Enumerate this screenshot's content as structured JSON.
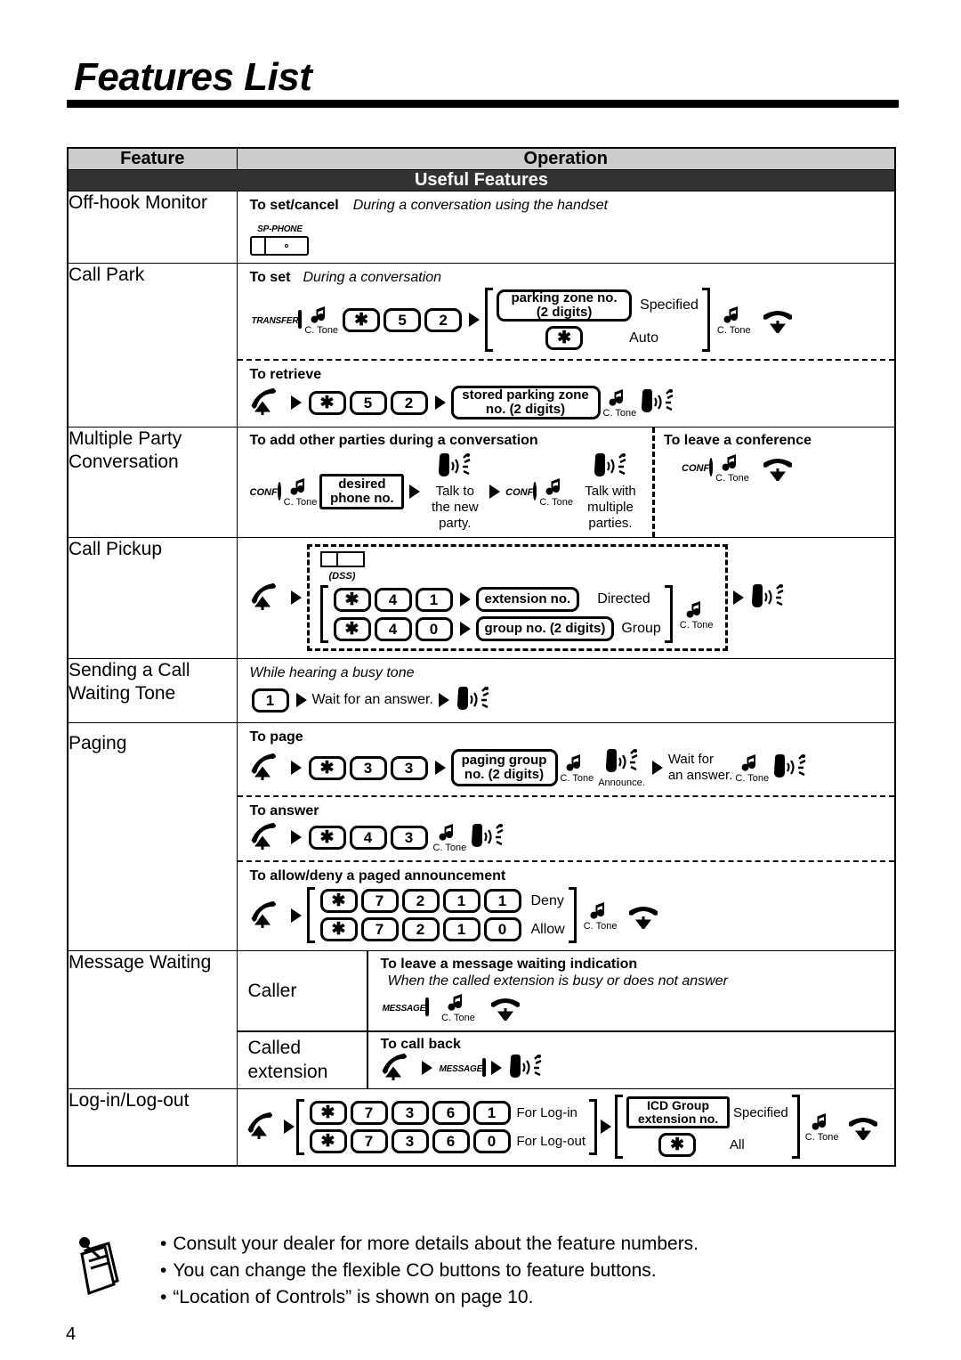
{
  "document": {
    "title": "Features List",
    "page_number": "4"
  },
  "table": {
    "headers": {
      "feature": "Feature",
      "operation": "Operation"
    },
    "section_band": "Useful Features"
  },
  "labels": {
    "c_tone": "C. Tone",
    "announce": "Announce.",
    "specified": "Specified",
    "auto": "Auto",
    "all": "All",
    "directed": "Directed",
    "group": "Group",
    "deny": "Deny",
    "allow": "Allow",
    "for_login": "For Log-in",
    "for_logout": "For Log-out",
    "wait_for_an_answer": "Wait for an answer.",
    "wait_for": "Wait for",
    "an_answer": "an answer.",
    "talk_to_the": "Talk to the",
    "new_party": "new party.",
    "talk_with": "Talk with",
    "multiple_parties": "multiple parties.",
    "sp_phone": "SP-PHONE",
    "transfer": "TRANSFER",
    "message": "MESSAGE",
    "conf": "CONF",
    "dss": "(DSS)",
    "star": "✱"
  },
  "rows": [
    {
      "feature": "Off-hook Monitor",
      "subrows": [
        {
          "heading": "To set/cancel",
          "subheading": "During a conversation using the handset"
        }
      ]
    },
    {
      "feature": "Call Park",
      "subrows": [
        {
          "heading": "To set",
          "subheading": "During a conversation",
          "keys": [
            "✱",
            "5",
            "2"
          ],
          "option1": "parking zone no. (2 digits)",
          "option1_label": "Specified",
          "option2": "✱",
          "option2_label": "Auto"
        },
        {
          "heading": "To retrieve",
          "keys": [
            "✱",
            "5",
            "2"
          ],
          "callout": "stored parking zone no. (2 digits)"
        }
      ]
    },
    {
      "feature": "Multiple Party Conversation",
      "subrows": [
        {
          "heading": "To add other parties during a conversation",
          "callout": "desired phone no.",
          "caption1": "Talk to the new party.",
          "caption2": "Talk with multiple parties."
        },
        {
          "heading": "To leave a conference"
        }
      ]
    },
    {
      "feature": "Call Pickup",
      "subrows": [
        {
          "keys1": [
            "✱",
            "4",
            "1"
          ],
          "callout1": "extension no.",
          "label1": "Directed",
          "keys2": [
            "✱",
            "4",
            "0"
          ],
          "callout2": "group no. (2 digits)",
          "label2": "Group"
        }
      ]
    },
    {
      "feature": "Sending a Call Waiting Tone",
      "subrows": [
        {
          "subheading": "While hearing a busy tone",
          "keys": [
            "1"
          ],
          "text": "Wait for an answer."
        }
      ]
    },
    {
      "feature": "Paging",
      "subrows": [
        {
          "heading": "To page",
          "keys": [
            "✱",
            "3",
            "3"
          ],
          "callout": "paging group no. (2 digits)"
        },
        {
          "heading": "To answer",
          "keys": [
            "✱",
            "4",
            "3"
          ]
        },
        {
          "heading": "To allow/deny a paged announcement",
          "keys1": [
            "✱",
            "7",
            "2",
            "1",
            "1"
          ],
          "label1": "Deny",
          "keys2": [
            "✱",
            "7",
            "2",
            "1",
            "0"
          ],
          "label2": "Allow"
        }
      ]
    },
    {
      "feature": "Message Waiting",
      "subfeatures": [
        {
          "name": "Caller",
          "heading": "To leave a message waiting indication",
          "subheading": "When the called extension is busy or does not answer"
        },
        {
          "name": "Called extension",
          "heading": "To call back"
        }
      ]
    },
    {
      "feature": "Log-in/Log-out",
      "subrows": [
        {
          "keys1": [
            "✱",
            "7",
            "3",
            "6",
            "1"
          ],
          "label1": "For Log-in",
          "keys2": [
            "✱",
            "7",
            "3",
            "6",
            "0"
          ],
          "label2": "For Log-out",
          "option1": "ICD Group extension no.",
          "option1_label": "Specified",
          "option2": "✱",
          "option2_label": "All"
        }
      ]
    }
  ],
  "notes": [
    "Consult your dealer for more details about the feature numbers.",
    "You can change the flexible CO buttons to feature buttons.",
    "“Location of Controls” is shown on page 10."
  ],
  "colors": {
    "header_bg": "#cccccc",
    "band_bg": "#333333",
    "ink": "#000000",
    "paper": "#ffffff"
  }
}
